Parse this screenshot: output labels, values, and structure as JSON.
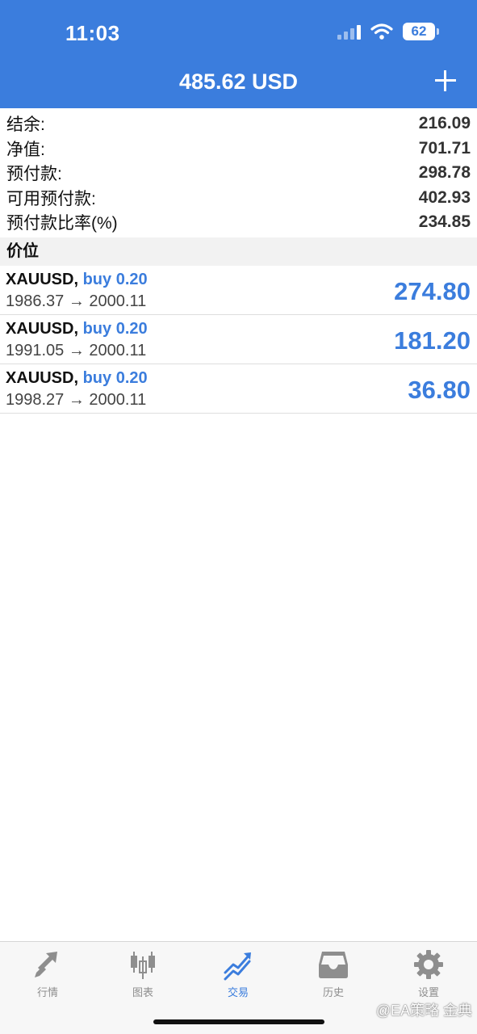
{
  "status_bar": {
    "time": "11:03",
    "battery": "62"
  },
  "header": {
    "title": "485.62 USD"
  },
  "summary": [
    {
      "label": "结余:",
      "value": "216.09"
    },
    {
      "label": "净值:",
      "value": "701.71"
    },
    {
      "label": "预付款:",
      "value": "298.78"
    },
    {
      "label": "可用预付款:",
      "value": "402.93"
    },
    {
      "label": "预付款比率(%)",
      "value": "234.85"
    }
  ],
  "positions_header": "价位",
  "positions": [
    {
      "symbol": "XAUUSD,",
      "side": "buy 0.20",
      "prices": "1986.37 → 2000.11",
      "profit": "274.80"
    },
    {
      "symbol": "XAUUSD,",
      "side": "buy 0.20",
      "prices": "1991.05 → 2000.11",
      "profit": "181.20"
    },
    {
      "symbol": "XAUUSD,",
      "side": "buy 0.20",
      "prices": "1998.27 → 2000.11",
      "profit": "36.80"
    }
  ],
  "tabs": [
    {
      "label": "行情",
      "icon": "quotes-arrows-icon"
    },
    {
      "label": "图表",
      "icon": "candlestick-chart-icon"
    },
    {
      "label": "交易",
      "icon": "trade-trend-icon"
    },
    {
      "label": "历史",
      "icon": "history-tray-icon"
    },
    {
      "label": "设置",
      "icon": "gear-icon"
    }
  ],
  "watermark": "@EA策略 金典",
  "colors": {
    "accent": "#3b7ddd",
    "tab_inactive": "#8e8e8e"
  }
}
